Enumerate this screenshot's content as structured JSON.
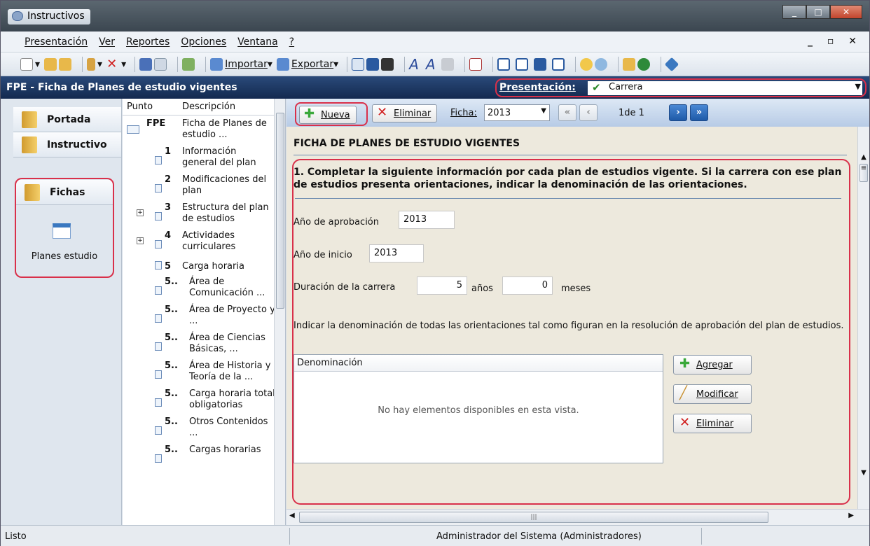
{
  "window": {
    "title": "Instructivos"
  },
  "menu": [
    "Presentación",
    "Ver",
    "Reportes",
    "Opciones",
    "Ventana",
    "?"
  ],
  "toolbar": {
    "importar": "Importar",
    "exportar": "Exportar"
  },
  "header": {
    "title": "FPE - Ficha de Planes de estudio vigentes",
    "presentacion_label": "Presentación:",
    "presentacion_value": "Carrera"
  },
  "nav": {
    "portada": "Portada",
    "instructivo": "Instructivo",
    "fichas": "Fichas",
    "planes": "Planes estudio"
  },
  "tree": {
    "col_punto": "Punto",
    "col_desc": "Descripción",
    "rows": [
      {
        "num": "FPE",
        "desc": "Ficha de Planes de estudio ..."
      },
      {
        "num": "1",
        "desc": "Información general del plan"
      },
      {
        "num": "2",
        "desc": "Modificaciones del plan"
      },
      {
        "num": "3",
        "desc": "Estructura del plan de estudios"
      },
      {
        "num": "4",
        "desc": "Actividades curriculares"
      },
      {
        "num": "5",
        "desc": "Carga horaria"
      },
      {
        "num": "5..",
        "desc": "Área de Comunicación ..."
      },
      {
        "num": "5..",
        "desc": "Área de Proyecto y ..."
      },
      {
        "num": "5..",
        "desc": "Área de Ciencias Básicas, ..."
      },
      {
        "num": "5..",
        "desc": "Área de Historia y Teoría de la ..."
      },
      {
        "num": "5..",
        "desc": "Carga horaria total obligatorias"
      },
      {
        "num": "5..",
        "desc": "Otros Contenidos ..."
      },
      {
        "num": "5..",
        "desc": "Cargas horarias"
      }
    ]
  },
  "ficha_toolbar": {
    "nueva": "Nueva",
    "eliminar": "Eliminar",
    "ficha_label": "Ficha:",
    "ficha_value": "2013",
    "page": "1de 1"
  },
  "form": {
    "title": "FICHA DE PLANES DE ESTUDIO VIGENTES",
    "question": "1. Completar la siguiente información por cada plan de estudios vigente. Si la carrera con ese plan de estudios presenta orientaciones, indicar la denominación de las orientaciones.",
    "anio_aprob_label": "Año de aprobación",
    "anio_aprob": "2013",
    "anio_inicio_label": "Año de inicio",
    "anio_inicio": "2013",
    "duracion_label": "Duración de la carrera",
    "duracion_anios": "5",
    "anios_label": "años",
    "duracion_meses": "0",
    "meses_label": "meses",
    "instr": "Indicar la denominación de todas las orientaciones tal como figuran en la resolución de aprobación del plan de estudios.",
    "grid_header": "Denominación",
    "grid_empty": "No hay elementos disponibles en esta vista.",
    "agregar": "Agregar",
    "modificar": "Modificar",
    "eliminar": "Eliminar"
  },
  "status": {
    "left": "Listo",
    "user": "Administrador del Sistema (Administradores)"
  }
}
